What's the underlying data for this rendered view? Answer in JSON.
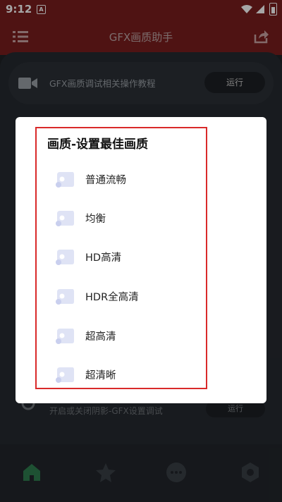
{
  "status": {
    "time": "9:12",
    "badge": "A"
  },
  "appbar": {
    "title": "GFX画质助手"
  },
  "rows": {
    "top": {
      "label": "GFX画质调试相关操作教程",
      "button": "运行"
    },
    "bottom": {
      "label": "开启或关闭阴影-GFX设置调试",
      "button": "运行"
    }
  },
  "dialog": {
    "title": "画质-设置最佳画质",
    "options": [
      {
        "label": "普通流畅",
        "icon": "quality-icon"
      },
      {
        "label": "均衡",
        "icon": "quality-icon"
      },
      {
        "label": "HD高清",
        "icon": "quality-icon"
      },
      {
        "label": "HDR全高清",
        "icon": "quality-icon"
      },
      {
        "label": "超高清",
        "icon": "quality-icon"
      },
      {
        "label": "超清晰",
        "icon": "quality-icon"
      }
    ]
  },
  "bottomnav": {
    "tabs": [
      "home-icon",
      "star-icon",
      "more-icon",
      "settings-icon"
    ],
    "active_color": "#2e7d4f"
  }
}
